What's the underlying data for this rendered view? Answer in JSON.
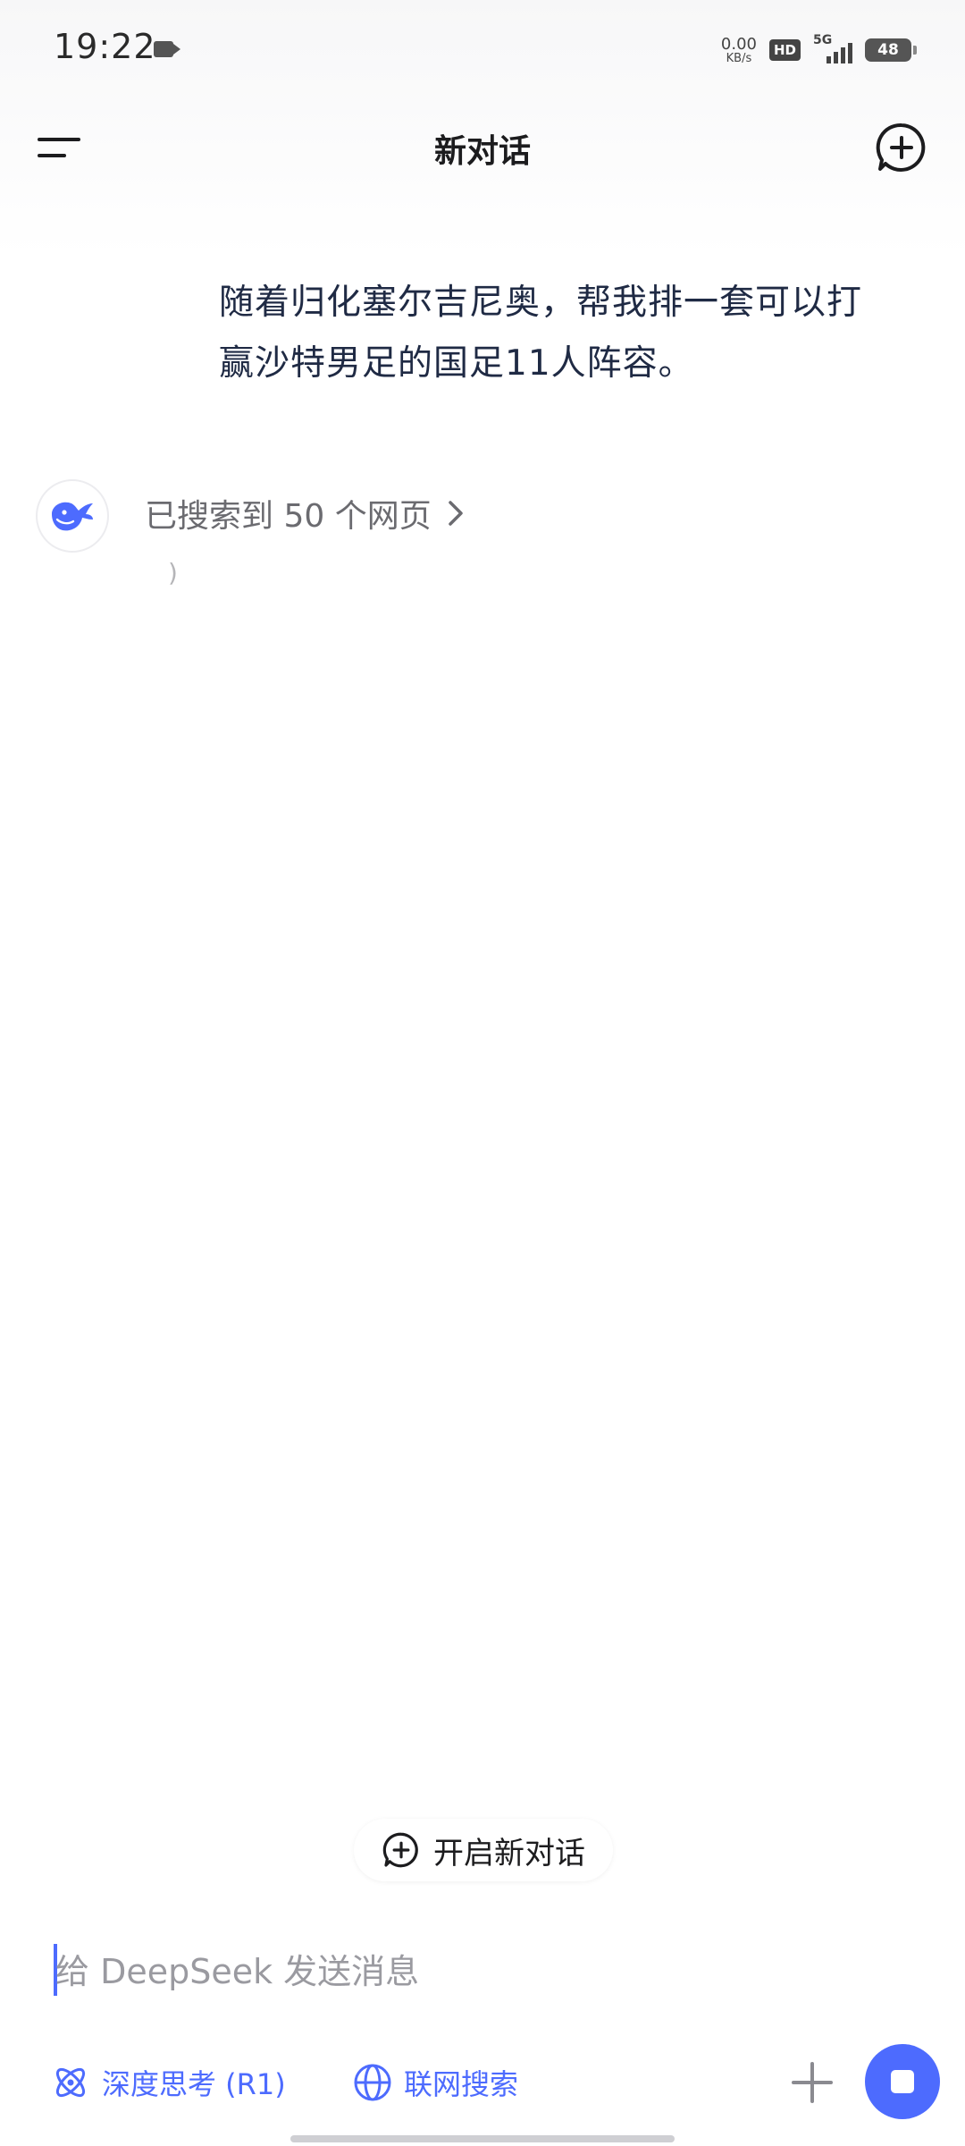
{
  "status_bar": {
    "time": "19:22",
    "net_speed_value": "0.00",
    "net_speed_unit": "KB/s",
    "hd_label": "HD",
    "network_label": "5G",
    "battery_level": "48"
  },
  "app_bar": {
    "title": "新对话",
    "menu_icon": "menu-icon",
    "new_chat_icon": "chat-plus-icon"
  },
  "conversation": {
    "user_message": "随着归化塞尔吉尼奥，帮我排一套可以打赢沙特男足的国足11人阵容。",
    "assistant": {
      "avatar_icon": "deepseek-whale-icon",
      "search_result_text": "已搜索到 50 个网页",
      "loading_mark": ")"
    }
  },
  "new_conversation_button": {
    "label": "开启新对话",
    "icon": "chat-plus-icon"
  },
  "composer": {
    "placeholder": "给 DeepSeek 发送消息",
    "deep_think_label": "深度思考 (R1)",
    "web_search_label": "联网搜索",
    "plus_icon": "plus-icon",
    "stop_icon": "stop-icon"
  },
  "colors": {
    "accent": "#4d6bfe",
    "text_primary": "#1c1c1e",
    "text_secondary": "#6b6b70",
    "user_text": "#1f2a44"
  }
}
